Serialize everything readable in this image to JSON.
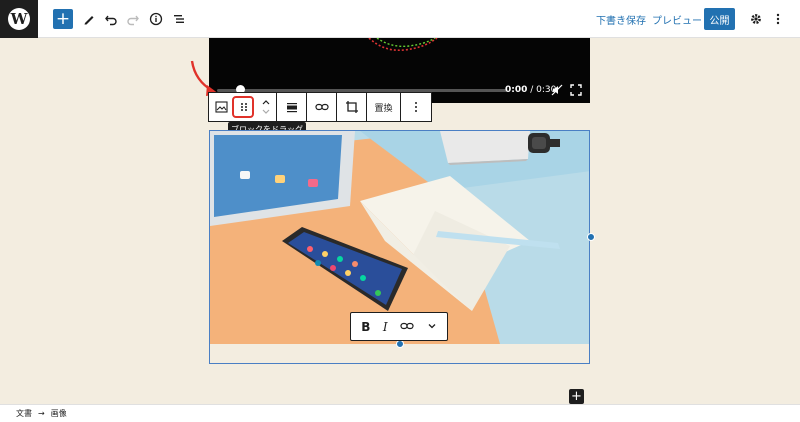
{
  "topbar": {
    "logo_letter": "W",
    "add_icon": "+",
    "save_draft_label": "下書き保存",
    "preview_label": "プレビュー",
    "publish_label": "公開",
    "icons": [
      "plus-icon",
      "pencil-icon",
      "undo-icon",
      "redo-icon",
      "info-icon",
      "list-view-icon",
      "gear-icon",
      "more-vertical-icon"
    ]
  },
  "video": {
    "current_time": "0:00",
    "duration": "/ 0:30"
  },
  "block_toolbar": {
    "replace_label": "置換",
    "tooltip": "ブロックをドラッグ"
  },
  "format_toolbar": {
    "bold": "B",
    "italic": "I"
  },
  "breadcrumb": {
    "root": "文書",
    "separator": "→",
    "current": "画像"
  },
  "colors": {
    "accent": "#2271b1",
    "highlight": "#e0322a",
    "canvas": "#f3ede0",
    "dark": "#1e1e1e"
  }
}
